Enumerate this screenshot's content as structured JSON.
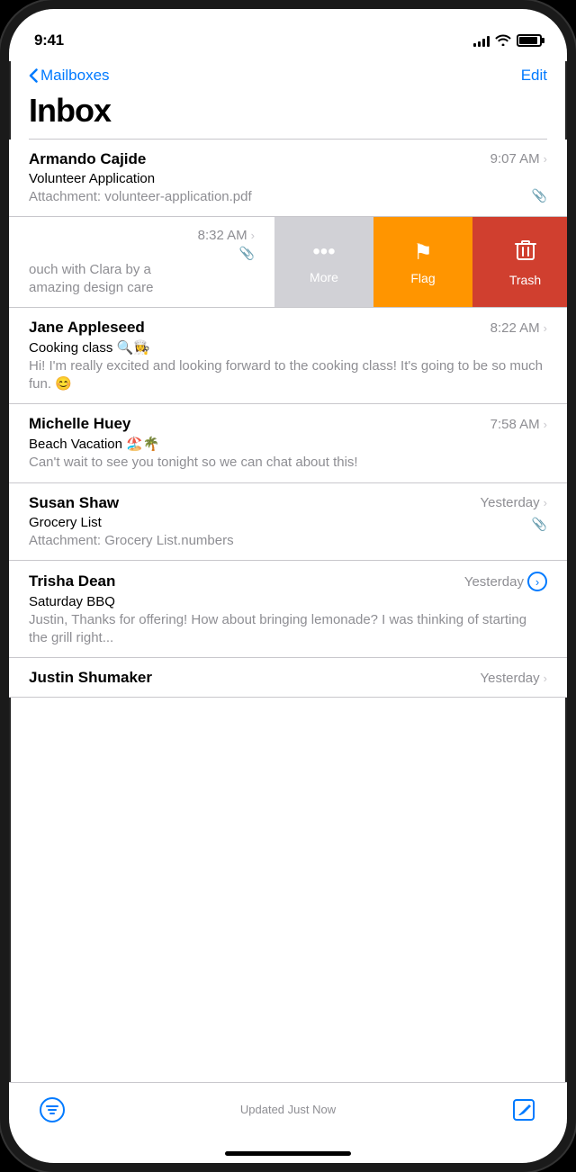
{
  "status_bar": {
    "time": "9:41",
    "signal_bars": [
      4,
      6,
      8,
      10,
      12
    ],
    "wifi": "wifi",
    "battery": "full"
  },
  "nav": {
    "back_label": "Mailboxes",
    "edit_label": "Edit"
  },
  "header": {
    "title": "Inbox"
  },
  "emails": [
    {
      "id": "email-1",
      "sender": "Armando Cajide",
      "time": "9:07 AM",
      "subject": "Volunteer Application",
      "preview": "Attachment: volunteer-application.pdf",
      "has_attachment": true,
      "unread": false,
      "thread": false,
      "swiped": false
    },
    {
      "id": "email-2",
      "sender": "",
      "time": "8:32 AM",
      "subject": "",
      "preview": "ouch with Clara by a amazing design care",
      "has_attachment": true,
      "unread": false,
      "thread": false,
      "swiped": true,
      "swipe_actions": [
        "More",
        "Flag",
        "Trash"
      ]
    },
    {
      "id": "email-3",
      "sender": "Jane Appleseed",
      "time": "8:22 AM",
      "subject": "Cooking class 🔍👩‍🍳",
      "preview": "Hi! I'm really excited and looking forward to the cooking class! It's going to be so much fun. 😊",
      "has_attachment": false,
      "unread": false,
      "thread": false,
      "swiped": false
    },
    {
      "id": "email-4",
      "sender": "Michelle Huey",
      "time": "7:58 AM",
      "subject": "Beach Vacation 🏖️🌴",
      "preview": "Can't wait to see you tonight so we can chat about this!",
      "has_attachment": false,
      "unread": false,
      "thread": false,
      "swiped": false
    },
    {
      "id": "email-5",
      "sender": "Susan Shaw",
      "time": "Yesterday",
      "subject": "Grocery List",
      "preview": "Attachment: Grocery List.numbers",
      "has_attachment": true,
      "unread": false,
      "thread": false,
      "swiped": false
    },
    {
      "id": "email-6",
      "sender": "Trisha Dean",
      "time": "Yesterday",
      "subject": "Saturday BBQ",
      "preview": "Justin, Thanks for offering! How about bringing lemonade? I was thinking of starting the grill right...",
      "has_attachment": false,
      "unread": false,
      "thread": true,
      "swiped": false
    },
    {
      "id": "email-7",
      "sender": "Justin Shumaker",
      "time": "Yesterday",
      "subject": "",
      "preview": "",
      "has_attachment": false,
      "unread": false,
      "thread": false,
      "swiped": false,
      "partial": true
    }
  ],
  "bottom": {
    "status": "Updated Just Now",
    "compose_icon": "compose",
    "filter_icon": "filter"
  },
  "swipe_actions": {
    "more_label": "More",
    "flag_label": "Flag",
    "trash_label": "Trash"
  }
}
